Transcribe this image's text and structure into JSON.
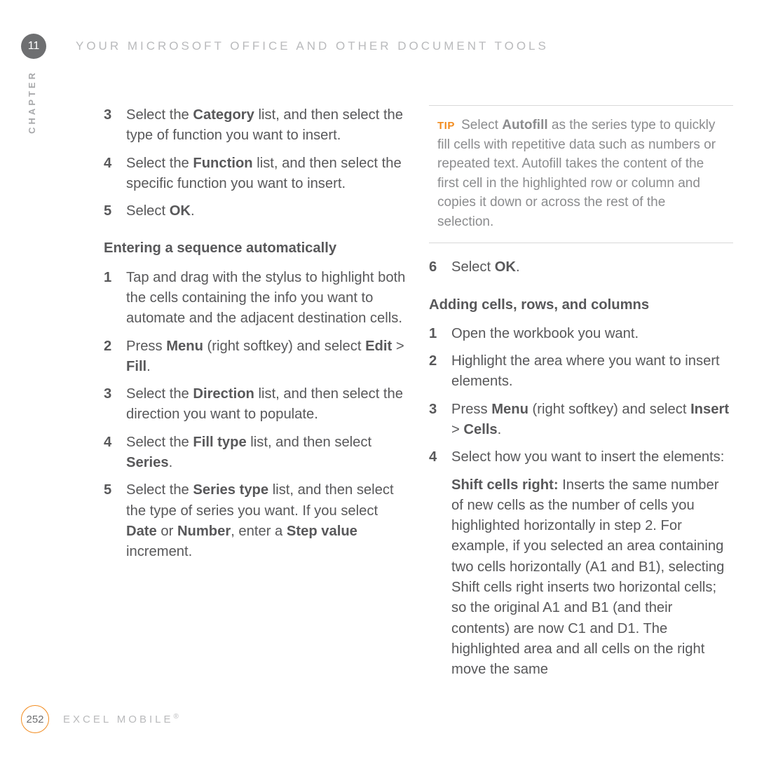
{
  "header": {
    "chapter_number": "11",
    "chapter_label": "CHAPTER",
    "page_title": "YOUR MICROSOFT OFFICE AND OTHER DOCUMENT TOOLS"
  },
  "left": {
    "s3_a": "Select the ",
    "s3_b": "Category",
    "s3_c": " list, and then select the type of function you want to insert.",
    "s4_a": "Select the ",
    "s4_b": "Function",
    "s4_c": " list, and then select the specific function you want to insert.",
    "s5_a": "Select ",
    "s5_b": "OK",
    "s5_c": ".",
    "heading1": "Entering a sequence automatically",
    "e1": "Tap and drag with the stylus to highlight both the cells containing the info you want to automate and the adjacent destination cells.",
    "e2_a": "Press ",
    "e2_b": "Menu",
    "e2_c": " (right softkey) and select ",
    "e2_d": "Edit",
    "e2_e": " > ",
    "e2_f": "Fill",
    "e2_g": ".",
    "e3_a": "Select the ",
    "e3_b": "Direction",
    "e3_c": " list, and then select the direction you want to populate.",
    "e4_a": "Select the ",
    "e4_b": "Fill type",
    "e4_c": " list, and then select ",
    "e4_d": "Series",
    "e4_e": ".",
    "e5_a": "Select the ",
    "e5_b": "Series type",
    "e5_c": " list, and then select the type of series you want. If you select ",
    "e5_d": "Date",
    "e5_e": " or ",
    "e5_f": "Number",
    "e5_g": ", enter a ",
    "e5_h": "Step value",
    "e5_i": " increment."
  },
  "right": {
    "tip_label": "TIP",
    "tip_a": "Select ",
    "tip_b": "Autofill",
    "tip_c": " as the series type to quickly fill cells with repetitive data such as numbers or repeated text. Autofill takes the content of the first cell in the highlighted row or column and copies it down or across the rest of the selection.",
    "s6_a": "Select ",
    "s6_b": "OK",
    "s6_c": ".",
    "heading2": "Adding cells, rows, and columns",
    "a1": "Open the workbook you want.",
    "a2": "Highlight the area where you want to insert elements.",
    "a3_a": "Press ",
    "a3_b": "Menu",
    "a3_c": " (right softkey) and select ",
    "a3_d": "Insert",
    "a3_e": " > ",
    "a3_f": "Cells",
    "a3_g": ".",
    "a4": "Select how you want to insert the elements:",
    "shift_label": "Shift cells right:",
    "shift_body": " Inserts the same number of new cells as the number of cells you highlighted horizontally in step 2. For example, if you selected an area containing two cells horizontally (A1 and B1), selecting Shift cells right inserts two horizontal cells; so the original A1 and B1 (and their contents) are now C1 and D1. The highlighted area and all cells on the right move the same"
  },
  "footer": {
    "page_number": "252",
    "section_title": "EXCEL MOBILE",
    "reg": "®"
  },
  "nums": {
    "n1": "1",
    "n2": "2",
    "n3": "3",
    "n4": "4",
    "n5": "5",
    "n6": "6"
  }
}
